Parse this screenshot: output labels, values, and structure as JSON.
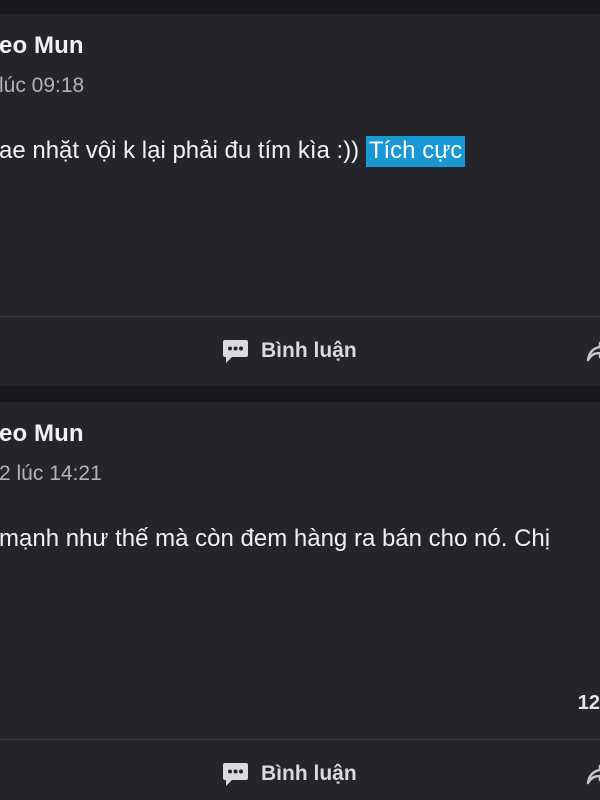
{
  "posts": [
    {
      "author": "eo Mun",
      "timestamp": "lúc 09:18",
      "text": "ae nhặt vội k lại phải đu tím kìa :)) ",
      "highlight_label": "Tích cực",
      "reaction_count": "",
      "comment_label": "Bình luận",
      "comment_icon": "comment-icon",
      "share_icon": "share-icon"
    },
    {
      "author": "eo Mun",
      "timestamp": "2 lúc 14:21",
      "text": "mạnh như thế mà còn đem hàng ra bán cho nó. Chị",
      "highlight_label": "",
      "reaction_count": "12",
      "comment_label": "Bình luận",
      "comment_icon": "comment-icon",
      "share_icon": "share-icon"
    }
  ],
  "colors": {
    "background": "#18191d",
    "card": "#24252a",
    "highlight": "#1a98d5",
    "text": "#f1f1f1",
    "muted": "#b0b3b8"
  }
}
